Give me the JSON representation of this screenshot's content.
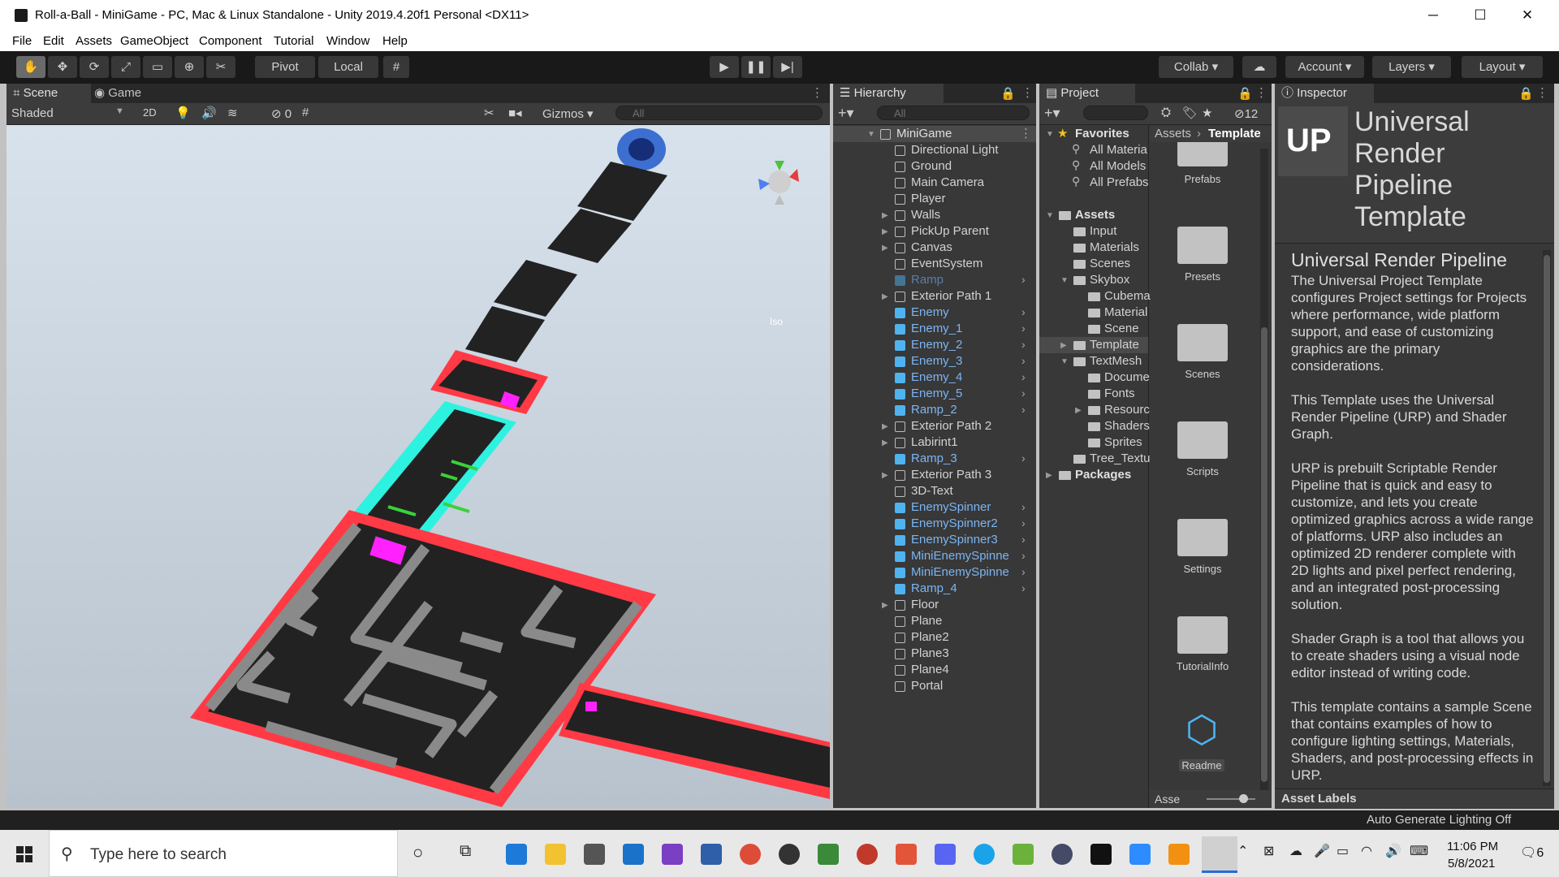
{
  "window": {
    "title": "Roll-a-Ball - MiniGame - PC, Mac & Linux Standalone - Unity 2019.4.20f1 Personal <DX11>",
    "minimize": "─",
    "maximize": "☐",
    "close": "✕"
  },
  "menu": [
    "File",
    "Edit",
    "Assets",
    "GameObject",
    "Component",
    "Tutorial",
    "Window",
    "Help"
  ],
  "toolbar": {
    "pivot": "Pivot",
    "local": "Local",
    "collab": "Collab",
    "account": "Account",
    "layers": "Layers",
    "layout": "Layout"
  },
  "scene": {
    "tab_scene": "Scene",
    "tab_game": "Game",
    "shading": "Shaded",
    "mode_2d": "2D",
    "hidden_count": "0",
    "gizmos": "Gizmos",
    "search_placeholder": "All",
    "gizmo_label": "Iso"
  },
  "hierarchy": {
    "tab": "Hierarchy",
    "search_placeholder": "All",
    "scene_name": "MiniGame",
    "items": [
      {
        "label": "Directional Light",
        "prefab": false,
        "expandable": false
      },
      {
        "label": "Ground",
        "prefab": false,
        "expandable": false
      },
      {
        "label": "Main Camera",
        "prefab": false,
        "expandable": false
      },
      {
        "label": "Player",
        "prefab": false,
        "expandable": false
      },
      {
        "label": "Walls",
        "prefab": false,
        "expandable": true
      },
      {
        "label": "PickUp Parent",
        "prefab": false,
        "expandable": true
      },
      {
        "label": "Canvas",
        "prefab": false,
        "expandable": true
      },
      {
        "label": "EventSystem",
        "prefab": false,
        "expandable": false
      },
      {
        "label": "Ramp",
        "prefab": true,
        "expandable": false,
        "disabled": true
      },
      {
        "label": "Exterior Path 1",
        "prefab": false,
        "expandable": true
      },
      {
        "label": "Enemy",
        "prefab": true,
        "expandable": false
      },
      {
        "label": "Enemy_1",
        "prefab": true,
        "expandable": false
      },
      {
        "label": "Enemy_2",
        "prefab": true,
        "expandable": false
      },
      {
        "label": "Enemy_3",
        "prefab": true,
        "expandable": false
      },
      {
        "label": "Enemy_4",
        "prefab": true,
        "expandable": false
      },
      {
        "label": "Enemy_5",
        "prefab": true,
        "expandable": false
      },
      {
        "label": "Ramp_2",
        "prefab": true,
        "expandable": false
      },
      {
        "label": "Exterior Path 2",
        "prefab": false,
        "expandable": true
      },
      {
        "label": "Labirint1",
        "prefab": false,
        "expandable": true
      },
      {
        "label": "Ramp_3",
        "prefab": true,
        "expandable": false
      },
      {
        "label": "Exterior Path 3",
        "prefab": false,
        "expandable": true
      },
      {
        "label": "3D-Text",
        "prefab": false,
        "expandable": false
      },
      {
        "label": "EnemySpinner",
        "prefab": true,
        "expandable": false
      },
      {
        "label": "EnemySpinner2",
        "prefab": true,
        "expandable": false
      },
      {
        "label": "EnemySpinner3",
        "prefab": true,
        "expandable": false
      },
      {
        "label": "MiniEnemySpinne",
        "prefab": true,
        "expandable": false
      },
      {
        "label": "MiniEnemySpinne",
        "prefab": true,
        "expandable": false
      },
      {
        "label": "Ramp_4",
        "prefab": true,
        "expandable": false
      },
      {
        "label": "Floor",
        "prefab": false,
        "expandable": true
      },
      {
        "label": "Plane",
        "prefab": false,
        "expandable": false
      },
      {
        "label": "Plane2",
        "prefab": false,
        "expandable": false
      },
      {
        "label": "Plane3",
        "prefab": false,
        "expandable": false
      },
      {
        "label": "Plane4",
        "prefab": false,
        "expandable": false
      },
      {
        "label": "Portal",
        "prefab": false,
        "expandable": false
      }
    ]
  },
  "project": {
    "tab": "Project",
    "hidden_count": "12",
    "breadcrumb_root": "Assets",
    "breadcrumb_current": "Template",
    "tree": [
      {
        "label": "Favorites",
        "indent": 0,
        "kind": "star",
        "expanded": true,
        "bold": true
      },
      {
        "label": "All Materia",
        "indent": 1,
        "kind": "search"
      },
      {
        "label": "All Models",
        "indent": 1,
        "kind": "search"
      },
      {
        "label": "All Prefabs",
        "indent": 1,
        "kind": "search"
      },
      {
        "label": "",
        "indent": 0,
        "kind": "spacer"
      },
      {
        "label": "Assets",
        "indent": 0,
        "kind": "folder",
        "expanded": true,
        "bold": true
      },
      {
        "label": "Input",
        "indent": 1,
        "kind": "folder"
      },
      {
        "label": "Materials",
        "indent": 1,
        "kind": "folder"
      },
      {
        "label": "Scenes",
        "indent": 1,
        "kind": "folder"
      },
      {
        "label": "Skybox",
        "indent": 1,
        "kind": "folder",
        "expanded": true
      },
      {
        "label": "Cubema",
        "indent": 2,
        "kind": "folder"
      },
      {
        "label": "Material",
        "indent": 2,
        "kind": "folder"
      },
      {
        "label": "Scene",
        "indent": 2,
        "kind": "folder"
      },
      {
        "label": "Template",
        "indent": 1,
        "kind": "folder",
        "collapsed": true,
        "selected": true
      },
      {
        "label": "TextMesh",
        "indent": 1,
        "kind": "folder",
        "expanded": true
      },
      {
        "label": "Docume",
        "indent": 2,
        "kind": "folder"
      },
      {
        "label": "Fonts",
        "indent": 2,
        "kind": "folder"
      },
      {
        "label": "Resourc",
        "indent": 2,
        "kind": "folder",
        "collapsed": true
      },
      {
        "label": "Shaders",
        "indent": 2,
        "kind": "folder"
      },
      {
        "label": "Sprites",
        "indent": 2,
        "kind": "folder"
      },
      {
        "label": "Tree_Textu",
        "indent": 1,
        "kind": "folder"
      },
      {
        "label": "Packages",
        "indent": 0,
        "kind": "folder",
        "collapsed": true,
        "bold": true
      }
    ],
    "grid": [
      "Prefabs",
      "Presets",
      "Scenes",
      "Scripts",
      "Settings",
      "TutorialInfo",
      "Readme"
    ],
    "footer_label": "Asse"
  },
  "inspector": {
    "tab": "Inspector",
    "logo_text": "UP",
    "title": "Universal Render Pipeline Template",
    "heading": "Universal Render Pipeline",
    "paragraphs": [
      "The Universal Project Template configures Project settings for Projects where performance, wide platform support, and ease of customizing graphics are the primary considerations.",
      "This Template uses the Universal Render Pipeline (URP) and Shader Graph.",
      "URP is prebuilt Scriptable Render Pipeline that is quick and easy to customize, and lets you create optimized graphics across a wide range of platforms. URP also includes an optimized 2D renderer complete with 2D lights and pixel perfect rendering, and an integrated post-processing solution.",
      "Shader Graph is a tool that allows you to create shaders using a visual node editor instead of writing code.",
      "This template contains a sample Scene that contains examples of how to configure lighting settings, Materials, Shaders, and post-processing effects in URP."
    ],
    "asset_labels": "Asset Labels"
  },
  "status": {
    "right": "Auto Generate Lighting Off"
  },
  "taskbar": {
    "search_placeholder": "Type here to search",
    "time": "11:06 PM",
    "date": "5/8/2021",
    "notifications": "6"
  },
  "colors": {
    "panel_bg": "#383838",
    "header_bg": "#282828",
    "prefab_blue": "#7cb5f2",
    "maze_red": "#ff3a45",
    "ramp_cyan": "#2ef2e0",
    "pickup_magenta": "#ff22ff"
  },
  "icons": [
    "unity-icon",
    "hand-tool-icon",
    "move-tool-icon",
    "rotate-tool-icon",
    "scale-tool-icon",
    "rect-tool-icon",
    "transform-tool-icon",
    "custom-tool-icon",
    "play-icon",
    "pause-icon",
    "step-icon",
    "cloud-icon",
    "search-icon",
    "lock-icon",
    "kebab-icon",
    "windows-start-icon",
    "cortana-icon",
    "task-view-icon"
  ]
}
